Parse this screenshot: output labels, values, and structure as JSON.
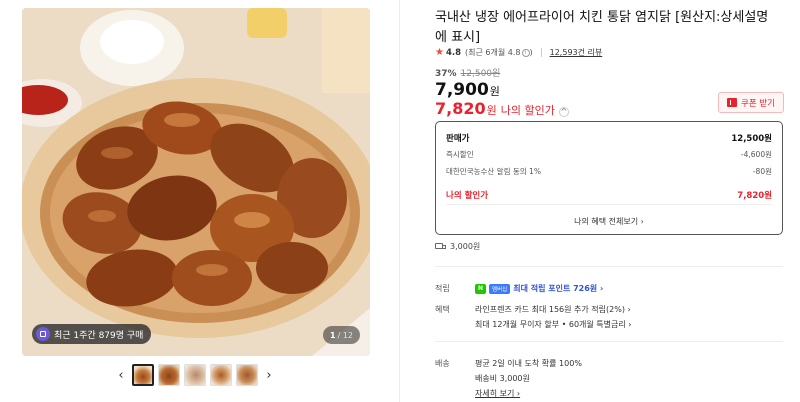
{
  "product": {
    "title": "국내산 냉장 에어프라이어 치킨 통닭 염지닭 [원산지:상세설명에 표시]",
    "rating": "4.8",
    "rating_sub": "(최근 6개월 4.8",
    "rating_sub_end": ")",
    "review_link": "12,593건 리뷰",
    "discount_rate": "37%",
    "original_price": "12,500원",
    "price": "7,900",
    "price_unit": "원",
    "my_price": "7,820",
    "my_price_unit": "원",
    "my_price_label": "나의 할인가",
    "coupon_button": "쿠폰 받기"
  },
  "image": {
    "buyer_badge": "최근 1주간 879명 구매",
    "page_current": "1",
    "page_total": "/ 12"
  },
  "price_box": {
    "rows": [
      {
        "label": "판매가",
        "value": "12,500원"
      },
      {
        "label": "즉시할인",
        "value": "-4,600원"
      },
      {
        "label": "대한민국농수산 알림 동의 1%",
        "value": "-80원"
      }
    ],
    "mine_label": "나의 할인가",
    "mine_value": "7,820원",
    "all_benefits_link": "나의 혜택 전체보기 ›"
  },
  "shipping_fee": "3,000원",
  "points": {
    "label": "적립",
    "npay": "N",
    "member": "멤버십",
    "text": "최대 적립 포인트 726원 ›"
  },
  "benefits": {
    "label": "혜택",
    "line1": "라인프렌즈 카드 최대 156원 추가 적립(2%) ›",
    "line2": "최대 12개월 무이자 할부 • 60개월 특별금리 ›"
  },
  "delivery": {
    "label": "배송",
    "line1": "평균 2일 이내 도착 확률 100%",
    "line2": "배송비 3,000원",
    "detail_link": "자세히 보기 ›"
  },
  "colors": {
    "accent_red": "#e8232e",
    "point_blue": "#2f55d4",
    "npay_green": "#1ec800"
  }
}
